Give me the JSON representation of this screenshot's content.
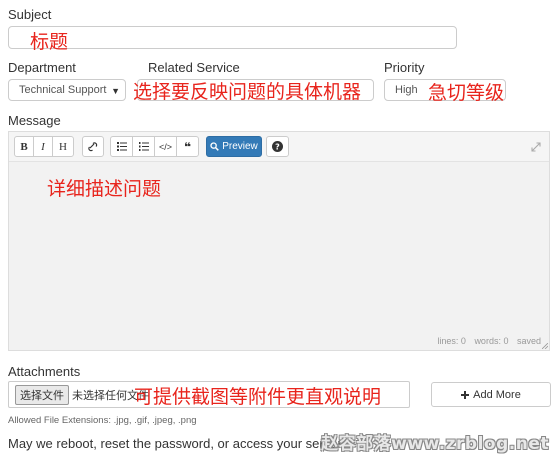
{
  "subject": {
    "label": "Subject",
    "annotation": "标题"
  },
  "department": {
    "label": "Department",
    "value": "Technical Support"
  },
  "related_service": {
    "label": "Related Service",
    "annotation": "选择要反映问题的具体机器"
  },
  "priority": {
    "label": "Priority",
    "value": "High",
    "annotation": "急切等级"
  },
  "message": {
    "label": "Message",
    "annotation": "详细描述问题",
    "toolbar": {
      "bold": "B",
      "italic": "I",
      "heading": "H",
      "preview": "Preview"
    },
    "status": {
      "lines": "lines: 0",
      "words": "words: 0",
      "saved": "saved"
    }
  },
  "attachments": {
    "label": "Attachments",
    "choose_button": "选择文件",
    "no_file": "未选择任何文件",
    "annotation": "可提供截图等附件更直观说明",
    "add_more": "Add More",
    "allowed": "Allowed File Extensions: .jpg, .gif, .jpeg, .png"
  },
  "reboot_question": "May we reboot, reset the password, or access your server?",
  "watermark": "赵容部落www.zrblog.net",
  "colors": {
    "accent": "#337ab7",
    "annotation": "#e8241c"
  }
}
